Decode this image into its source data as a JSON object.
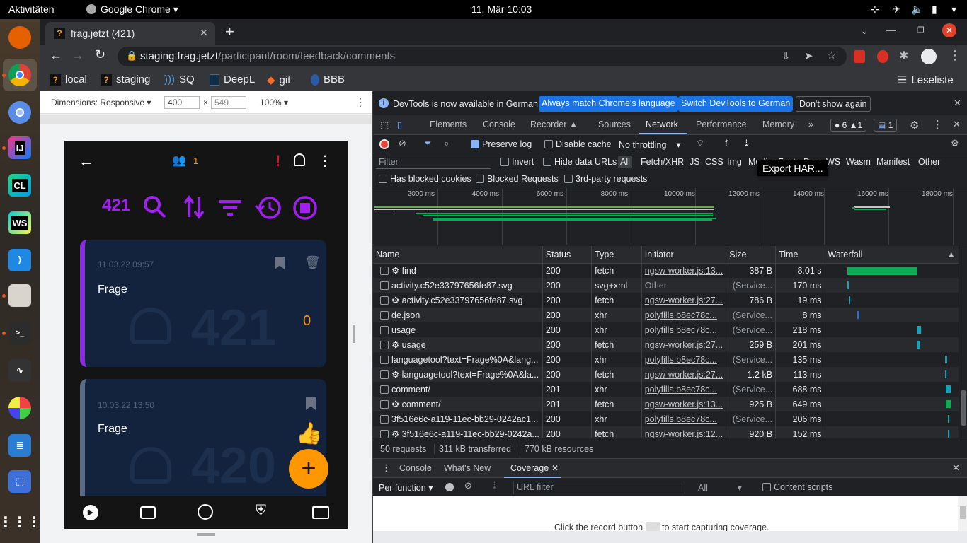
{
  "topbar": {
    "activities": "Aktivitäten",
    "app": "Google Chrome",
    "datetime": "11. Mär  10:03"
  },
  "dock": {
    "icons": [
      "firefox-icon",
      "chrome-icon",
      "chromium-icon",
      "intellij-icon",
      "clion-icon",
      "webstorm-icon",
      "vscode-icon",
      "files-icon",
      "terminal-icon",
      "system-monitor-icon",
      "color-picker-icon",
      "document-viewer-icon",
      "screenshot-icon",
      "app-grid-icon"
    ],
    "labels": {
      "intellij": "IJ",
      "clion": "CL",
      "webstorm": "WS"
    }
  },
  "tab": {
    "title": "frag.jetzt (421)",
    "favicon": "?"
  },
  "toolbar": {
    "url_host": "staging.frag.jetzt",
    "url_path": "/participant/room/feedback/comments"
  },
  "bookmarks": [
    {
      "label": "local",
      "icon": "?"
    },
    {
      "label": "staging",
      "icon": "?"
    },
    {
      "label": "SQ",
      "icon": ""
    },
    {
      "label": "DeepL",
      "icon": ""
    },
    {
      "label": "git",
      "icon": ""
    },
    {
      "label": "BBB",
      "icon": ""
    }
  ],
  "reading_list": "Leseliste",
  "device_toolbar": {
    "dimensions": "Dimensions: Responsive",
    "width": "400",
    "x": "×",
    "height": "549",
    "zoom": "100%"
  },
  "app": {
    "user_count": "1",
    "room_count": "421",
    "cards": [
      {
        "time": "11.03.22 09:57",
        "text": "Frage",
        "number": "421",
        "votes": "0",
        "accent": "#8a2be2"
      },
      {
        "time": "10.03.22 13:50",
        "text": "Frage",
        "number": "420",
        "accent": "#5a6a86"
      }
    ],
    "fab": "+"
  },
  "devtools": {
    "infobar": {
      "text": "DevTools is now available in German!",
      "btn1": "Always match Chrome's language",
      "btn2": "Switch DevTools to German",
      "btn3": "Don't show again"
    },
    "panels": [
      "Elements",
      "Console",
      "Recorder ▲",
      "Sources",
      "Network",
      "Performance",
      "Memory"
    ],
    "more_panels": "»",
    "badges": {
      "errors": "6",
      "warnings": "1",
      "messages": "1"
    },
    "network_toolbar": {
      "preserve_log": "Preserve log",
      "disable_cache": "Disable cache",
      "throttling": "No throttling"
    },
    "filter": {
      "placeholder": "Filter",
      "invert": "Invert",
      "hide_data": "Hide data URLs",
      "types": [
        "All",
        "Fetch/XHR",
        "JS",
        "CSS",
        "Img",
        "Media",
        "Font",
        "Doc",
        "WS",
        "Wasm",
        "Manifest",
        "Other"
      ]
    },
    "filter2": {
      "blocked_cookies": "Has blocked cookies",
      "blocked_requests": "Blocked Requests",
      "third_party": "3rd-party requests"
    },
    "tooltip": "Export HAR...",
    "timeline_ticks": [
      "2000 ms",
      "4000 ms",
      "6000 ms",
      "8000 ms",
      "10000 ms",
      "12000 ms",
      "14000 ms",
      "16000 ms",
      "18000 ms"
    ],
    "columns": [
      "Name",
      "Status",
      "Type",
      "Initiator",
      "Size",
      "Time",
      "Waterfall"
    ],
    "rows": [
      {
        "name": "⚙ find",
        "status": "200",
        "type": "fetch",
        "initiator": "ngsw-worker.js:13...",
        "size": "387 B",
        "time": "8.01 s",
        "wf_start": 0.16,
        "wf_len": 0.58,
        "color": "#0fa958",
        "link": true
      },
      {
        "name": "activity.c52e33797656fe87.svg",
        "status": "200",
        "type": "svg+xml",
        "initiator": "Other",
        "size": "(Service...",
        "time": "170 ms",
        "wf_start": 0.16,
        "wf_len": 0.02,
        "color": "#14a3b8",
        "link": false
      },
      {
        "name": "⚙ activity.c52e33797656fe87.svg",
        "status": "200",
        "type": "fetch",
        "initiator": "ngsw-worker.js:27...",
        "size": "786 B",
        "time": "19 ms",
        "wf_start": 0.17,
        "wf_len": 0.01,
        "color": "#14a3b8",
        "link": true
      },
      {
        "name": "de.json",
        "status": "200",
        "type": "xhr",
        "initiator": "polyfills.b8ec78c...",
        "size": "(Service...",
        "time": "8 ms",
        "wf_start": 0.24,
        "wf_len": 0.01,
        "color": "#1a73e8",
        "link": true
      },
      {
        "name": "usage",
        "status": "200",
        "type": "xhr",
        "initiator": "polyfills.b8ec78c...",
        "size": "(Service...",
        "time": "218 ms",
        "wf_start": 0.74,
        "wf_len": 0.03,
        "color": "#14a3b8",
        "link": true
      },
      {
        "name": "⚙ usage",
        "status": "200",
        "type": "fetch",
        "initiator": "ngsw-worker.js:27...",
        "size": "259 B",
        "time": "201 ms",
        "wf_start": 0.74,
        "wf_len": 0.02,
        "color": "#14a3b8",
        "link": true
      },
      {
        "name": "languagetool?text=Frage%0A&lang...",
        "status": "200",
        "type": "xhr",
        "initiator": "polyfills.b8ec78c...",
        "size": "(Service...",
        "time": "135 ms",
        "wf_start": 0.97,
        "wf_len": 0.015,
        "color": "#14a3b8",
        "link": true
      },
      {
        "name": "⚙ languagetool?text=Frage%0A&la...",
        "status": "200",
        "type": "fetch",
        "initiator": "ngsw-worker.js:27...",
        "size": "1.2 kB",
        "time": "113 ms",
        "wf_start": 0.97,
        "wf_len": 0.012,
        "color": "#14a3b8",
        "link": true
      },
      {
        "name": "comment/",
        "status": "201",
        "type": "xhr",
        "initiator": "polyfills.b8ec78c...",
        "size": "(Service...",
        "time": "688 ms",
        "wf_start": 0.975,
        "wf_len": 0.04,
        "color": "#14a3b8",
        "link": true
      },
      {
        "name": "⚙ comment/",
        "status": "201",
        "type": "fetch",
        "initiator": "ngsw-worker.js:13...",
        "size": "925 B",
        "time": "649 ms",
        "wf_start": 0.975,
        "wf_len": 0.04,
        "color": "#0fa958",
        "link": true
      },
      {
        "name": "3f516e6c-a119-11ec-bb29-0242ac1...",
        "status": "200",
        "type": "xhr",
        "initiator": "polyfills.b8ec78c...",
        "size": "(Service...",
        "time": "206 ms",
        "wf_start": 0.99,
        "wf_len": 0.005,
        "color": "#14a3b8",
        "link": true
      },
      {
        "name": "⚙ 3f516e6c-a119-11ec-bb29-0242a...",
        "status": "200",
        "type": "fetch",
        "initiator": "ngsw-worker.js:12...",
        "size": "920 B",
        "time": "152 ms",
        "wf_start": 0.99,
        "wf_len": 0.005,
        "color": "#14a3b8",
        "link": true
      }
    ],
    "summary": {
      "requests": "50 requests",
      "transferred": "311 kB transferred",
      "resources": "770 kB resources"
    },
    "drawer": {
      "tabs": [
        "Console",
        "What's New",
        "Coverage"
      ],
      "per_function": "Per function",
      "url_filter": "URL filter",
      "all": "All",
      "content_scripts": "Content scripts",
      "hint": "Click the record button",
      "hint2": "to start capturing coverage."
    }
  }
}
